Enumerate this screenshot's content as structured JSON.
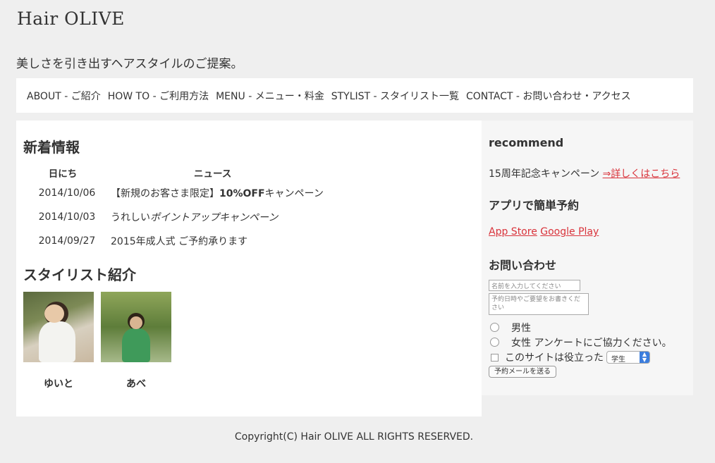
{
  "header": {
    "logo": "Hair OLIVE",
    "tagline": "美しさを引き出すヘアスタイルのご提案。"
  },
  "nav": [
    "ABOUT - ご紹介",
    "HOW TO - ご利用方法",
    "MENU - メニュー・料金",
    "STYLIST - スタイリスト一覧",
    "CONTACT - お問い合わせ・アクセス"
  ],
  "news": {
    "title": "新着情報",
    "col_date": "日にち",
    "col_news": "ニュース",
    "rows": [
      {
        "date": "2014/10/06",
        "pre": "【新規のお客さま限定】",
        "bold": "10%OFF",
        "post": "キャンペーン"
      },
      {
        "date": "2014/10/03",
        "pre": "うれしい",
        "bold": "",
        "post": "ポイントアップキャンペーン"
      },
      {
        "date": "2014/09/27",
        "pre": "2015年成人式 ご予約承ります",
        "bold": "",
        "post": ""
      }
    ]
  },
  "stylists": {
    "title": "スタイリスト紹介",
    "items": [
      {
        "name": "ゆいと"
      },
      {
        "name": "あべ"
      }
    ]
  },
  "sidebar": {
    "recommend_title": "recommend",
    "recommend_text": "15周年記念キャンペーン ",
    "recommend_link": "⇒詳しくはこちら",
    "app_title": "アプリで簡単予約",
    "app_store": "App Store",
    "google_play": "Google Play",
    "contact_title": "お問い合わせ",
    "name_placeholder": "名前を入力してください",
    "request_placeholder": "予約日時やご要望をお書きください",
    "gender_male": "男性",
    "gender_female": "女性",
    "survey_text": "アンケートにご協力ください。",
    "useful_label": "このサイトは役立った",
    "select_value": "学生",
    "submit_label": "予約メールを送る"
  },
  "footer": {
    "copyright": "Copyright(C) Hair OLIVE ALL RIGHTS RESERVED."
  },
  "colors": {
    "background": "#efefef",
    "panel": "#ffffff",
    "sidebar": "#f6f6f6",
    "link": "#d9333b"
  }
}
